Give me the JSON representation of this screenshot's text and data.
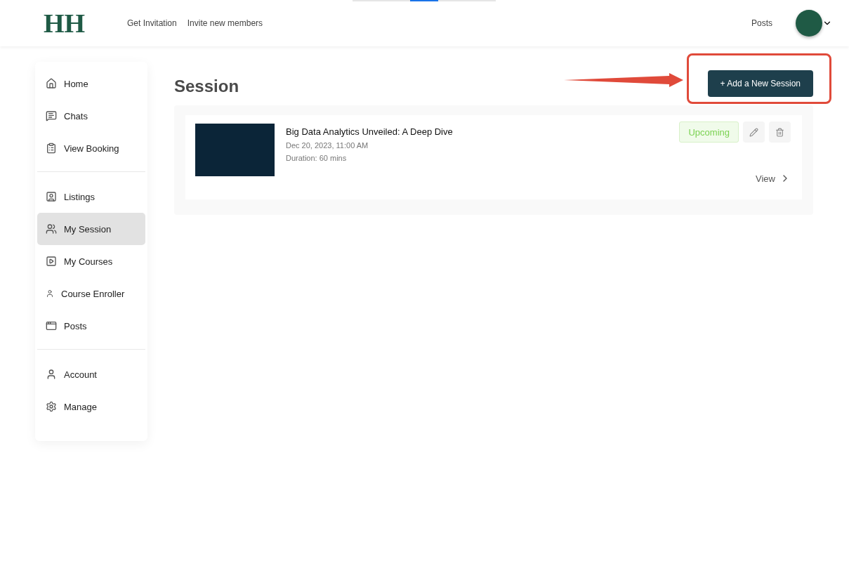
{
  "header": {
    "logo": "HH",
    "nav": [
      "Get Invitation",
      "Invite new members"
    ],
    "right_link": "Posts"
  },
  "sidebar": {
    "groups": [
      {
        "items": [
          {
            "label": "Home",
            "selected": false
          },
          {
            "label": "Chats",
            "selected": false
          },
          {
            "label": "View Booking",
            "selected": false
          }
        ]
      },
      {
        "items": [
          {
            "label": "Listings",
            "selected": false
          },
          {
            "label": "My Session",
            "selected": true
          },
          {
            "label": "My Courses",
            "selected": false
          },
          {
            "label": "Course Enroller",
            "selected": false
          },
          {
            "label": "Posts",
            "selected": false
          }
        ]
      },
      {
        "items": [
          {
            "label": "Account",
            "selected": false
          },
          {
            "label": "Manage",
            "selected": false
          }
        ]
      }
    ]
  },
  "main": {
    "title": "Session",
    "add_button": "+ Add a New Session",
    "sessions": [
      {
        "title": "Big Data Analytics Unveiled: A Deep Dive",
        "date": "Dec 20, 2023, 11:00 AM",
        "duration": "Duration: 60 mins",
        "status": "Upcoming",
        "view": "View"
      }
    ]
  }
}
